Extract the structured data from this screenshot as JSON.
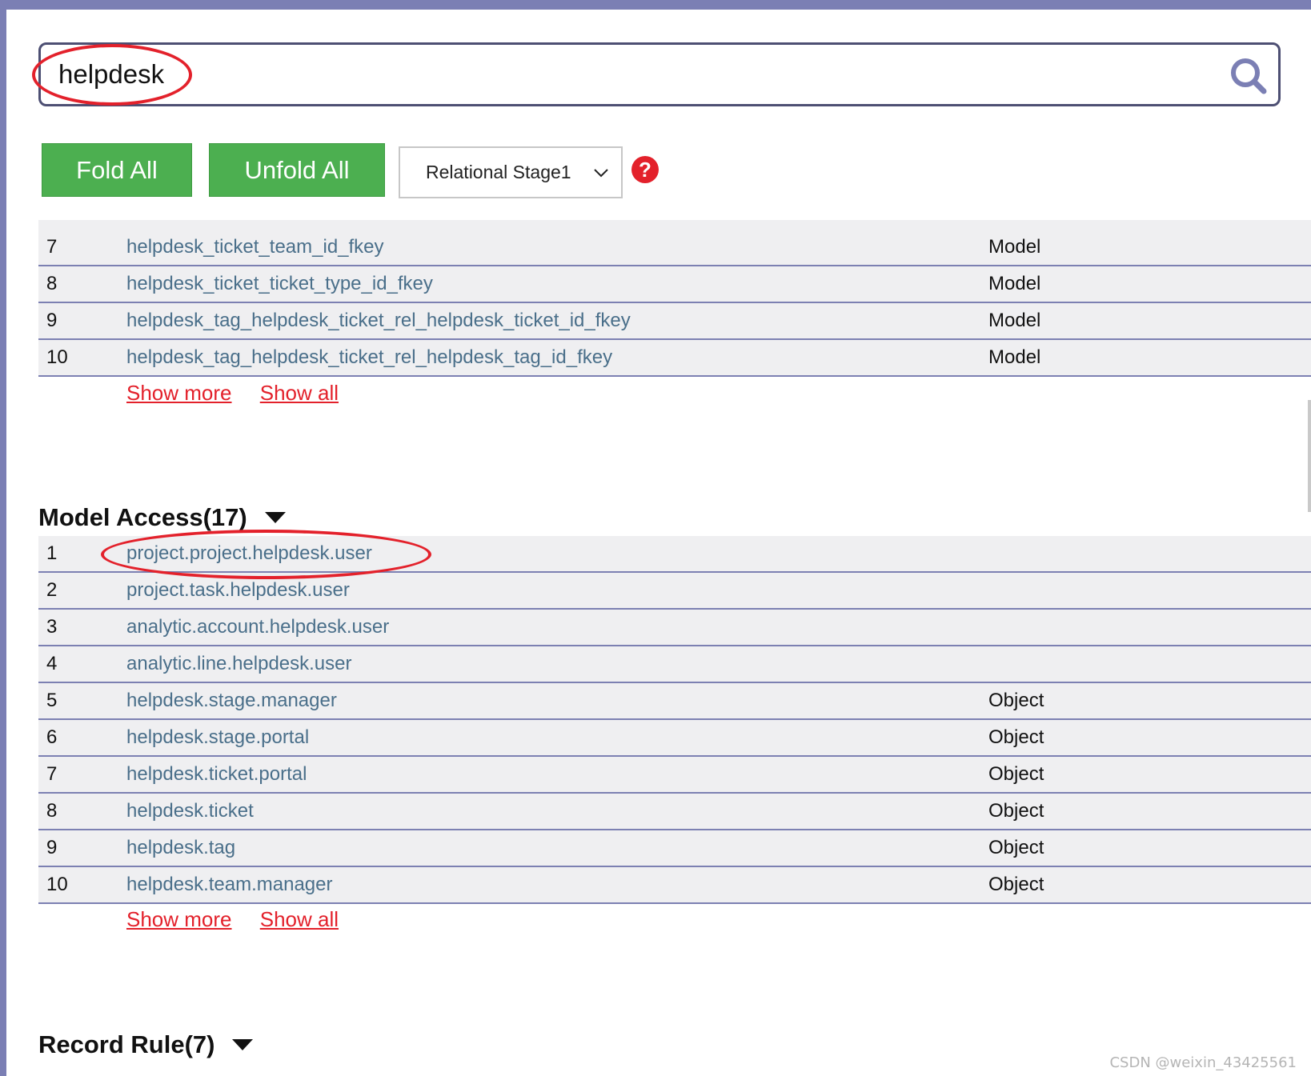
{
  "search": {
    "value": "helpdesk"
  },
  "toolbar": {
    "fold_all": "Fold All",
    "unfold_all": "Unfold All",
    "stage_selected": "Relational Stage1"
  },
  "fkey_section": {
    "rows": [
      {
        "num": "7",
        "name": "helpdesk_ticket_team_id_fkey",
        "type": "Model"
      },
      {
        "num": "8",
        "name": "helpdesk_ticket_ticket_type_id_fkey",
        "type": "Model"
      },
      {
        "num": "9",
        "name": "helpdesk_tag_helpdesk_ticket_rel_helpdesk_ticket_id_fkey",
        "type": "Model"
      },
      {
        "num": "10",
        "name": "helpdesk_tag_helpdesk_ticket_rel_helpdesk_tag_id_fkey",
        "type": "Model"
      }
    ],
    "show_more": "Show more",
    "show_all": "Show all"
  },
  "model_access": {
    "title": "Model Access(17)",
    "rows": [
      {
        "num": "1",
        "name": "project.project.helpdesk.user",
        "type": ""
      },
      {
        "num": "2",
        "name": "project.task.helpdesk.user",
        "type": ""
      },
      {
        "num": "3",
        "name": "analytic.account.helpdesk.user",
        "type": ""
      },
      {
        "num": "4",
        "name": "analytic.line.helpdesk.user",
        "type": ""
      },
      {
        "num": "5",
        "name": "helpdesk.stage.manager",
        "type": "Object"
      },
      {
        "num": "6",
        "name": "helpdesk.stage.portal",
        "type": "Object"
      },
      {
        "num": "7",
        "name": "helpdesk.ticket.portal",
        "type": "Object"
      },
      {
        "num": "8",
        "name": "helpdesk.ticket",
        "type": "Object"
      },
      {
        "num": "9",
        "name": "helpdesk.tag",
        "type": "Object"
      },
      {
        "num": "10",
        "name": "helpdesk.team.manager",
        "type": "Object"
      }
    ],
    "show_more": "Show more",
    "show_all": "Show all"
  },
  "record_rule": {
    "title": "Record Rule(7)"
  },
  "watermark": "CSDN @weixin_43425561",
  "colors": {
    "accent_bar": "#7b7fb4",
    "button_green": "#4caf50",
    "link_red": "#e3212b",
    "row_link": "#4a6f8a"
  },
  "icons": {
    "search": "search-icon",
    "help": "question-circle-icon",
    "dropdown": "chevron-down-icon",
    "caret": "caret-down-icon"
  }
}
